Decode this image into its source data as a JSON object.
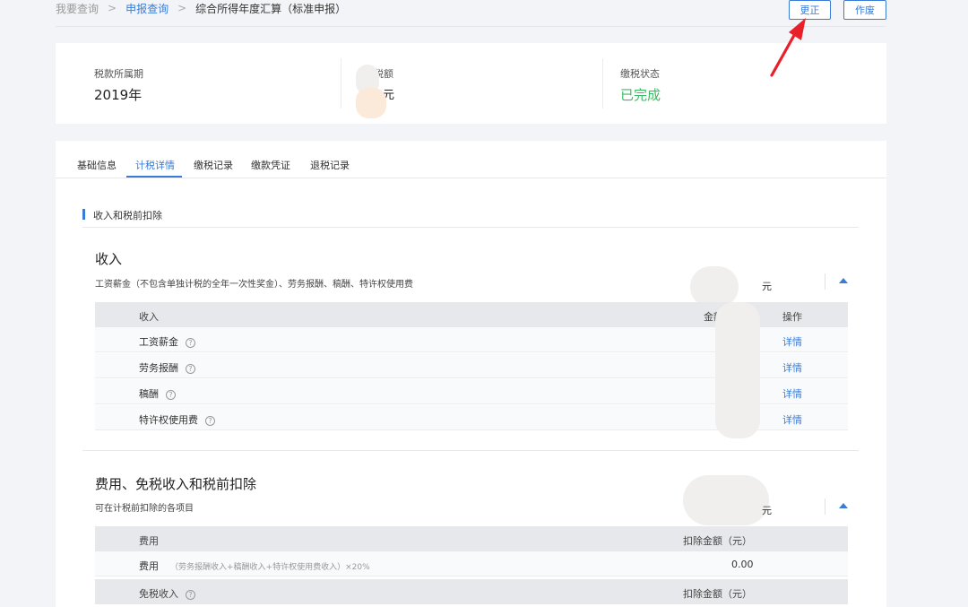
{
  "breadcrumb": {
    "items": [
      "我要查询",
      "申报查询",
      "综合所得年度汇算（标准申报）"
    ],
    "separator": ">"
  },
  "actions": {
    "correct_label": "更正",
    "void_label": "作废"
  },
  "summary": {
    "period_label": "税款所属期",
    "period_value": "2019年",
    "amount_label_partial": "税额",
    "amount_value_partial": "元",
    "status_label": "缴税状态",
    "status_value": "已完成"
  },
  "tabs": [
    "基础信息",
    "计税详情",
    "缴税记录",
    "缴款凭证",
    "退税记录"
  ],
  "active_tab_index": 1,
  "section": {
    "title": "收入和税前扣除"
  },
  "income": {
    "title": "收入",
    "subtitle": "工资薪金（不包含单独计税的全年一次性奖金）、劳务报酬、稿酬、特许权使用费",
    "unit": "元",
    "headers": {
      "name": "收入",
      "amount": "金额（元）",
      "action": "操作"
    },
    "rows": [
      {
        "name": "工资薪金",
        "action": "详情"
      },
      {
        "name": "劳务报酬",
        "action": "详情"
      },
      {
        "name": "稿酬",
        "action": "详情"
      },
      {
        "name": "特许权使用费",
        "action": "详情"
      }
    ],
    "help_glyph": "?"
  },
  "deduction": {
    "title": "费用、免税收入和税前扣除",
    "subtitle": "可在计税前扣除的各项目",
    "unit": "元",
    "fee_header": {
      "name": "费用",
      "amount": "扣除金额（元）"
    },
    "fee_row": {
      "name": "费用",
      "formula": "（劳务报酬收入+稿酬收入+特许权使用费收入）×20%",
      "amount": "0.00"
    },
    "exempt_header": {
      "name": "免税收入",
      "amount": "扣除金额（元）"
    }
  },
  "colors": {
    "accent": "#3a7bd5",
    "success": "#3dbb62",
    "arrow": "#e8202a"
  }
}
